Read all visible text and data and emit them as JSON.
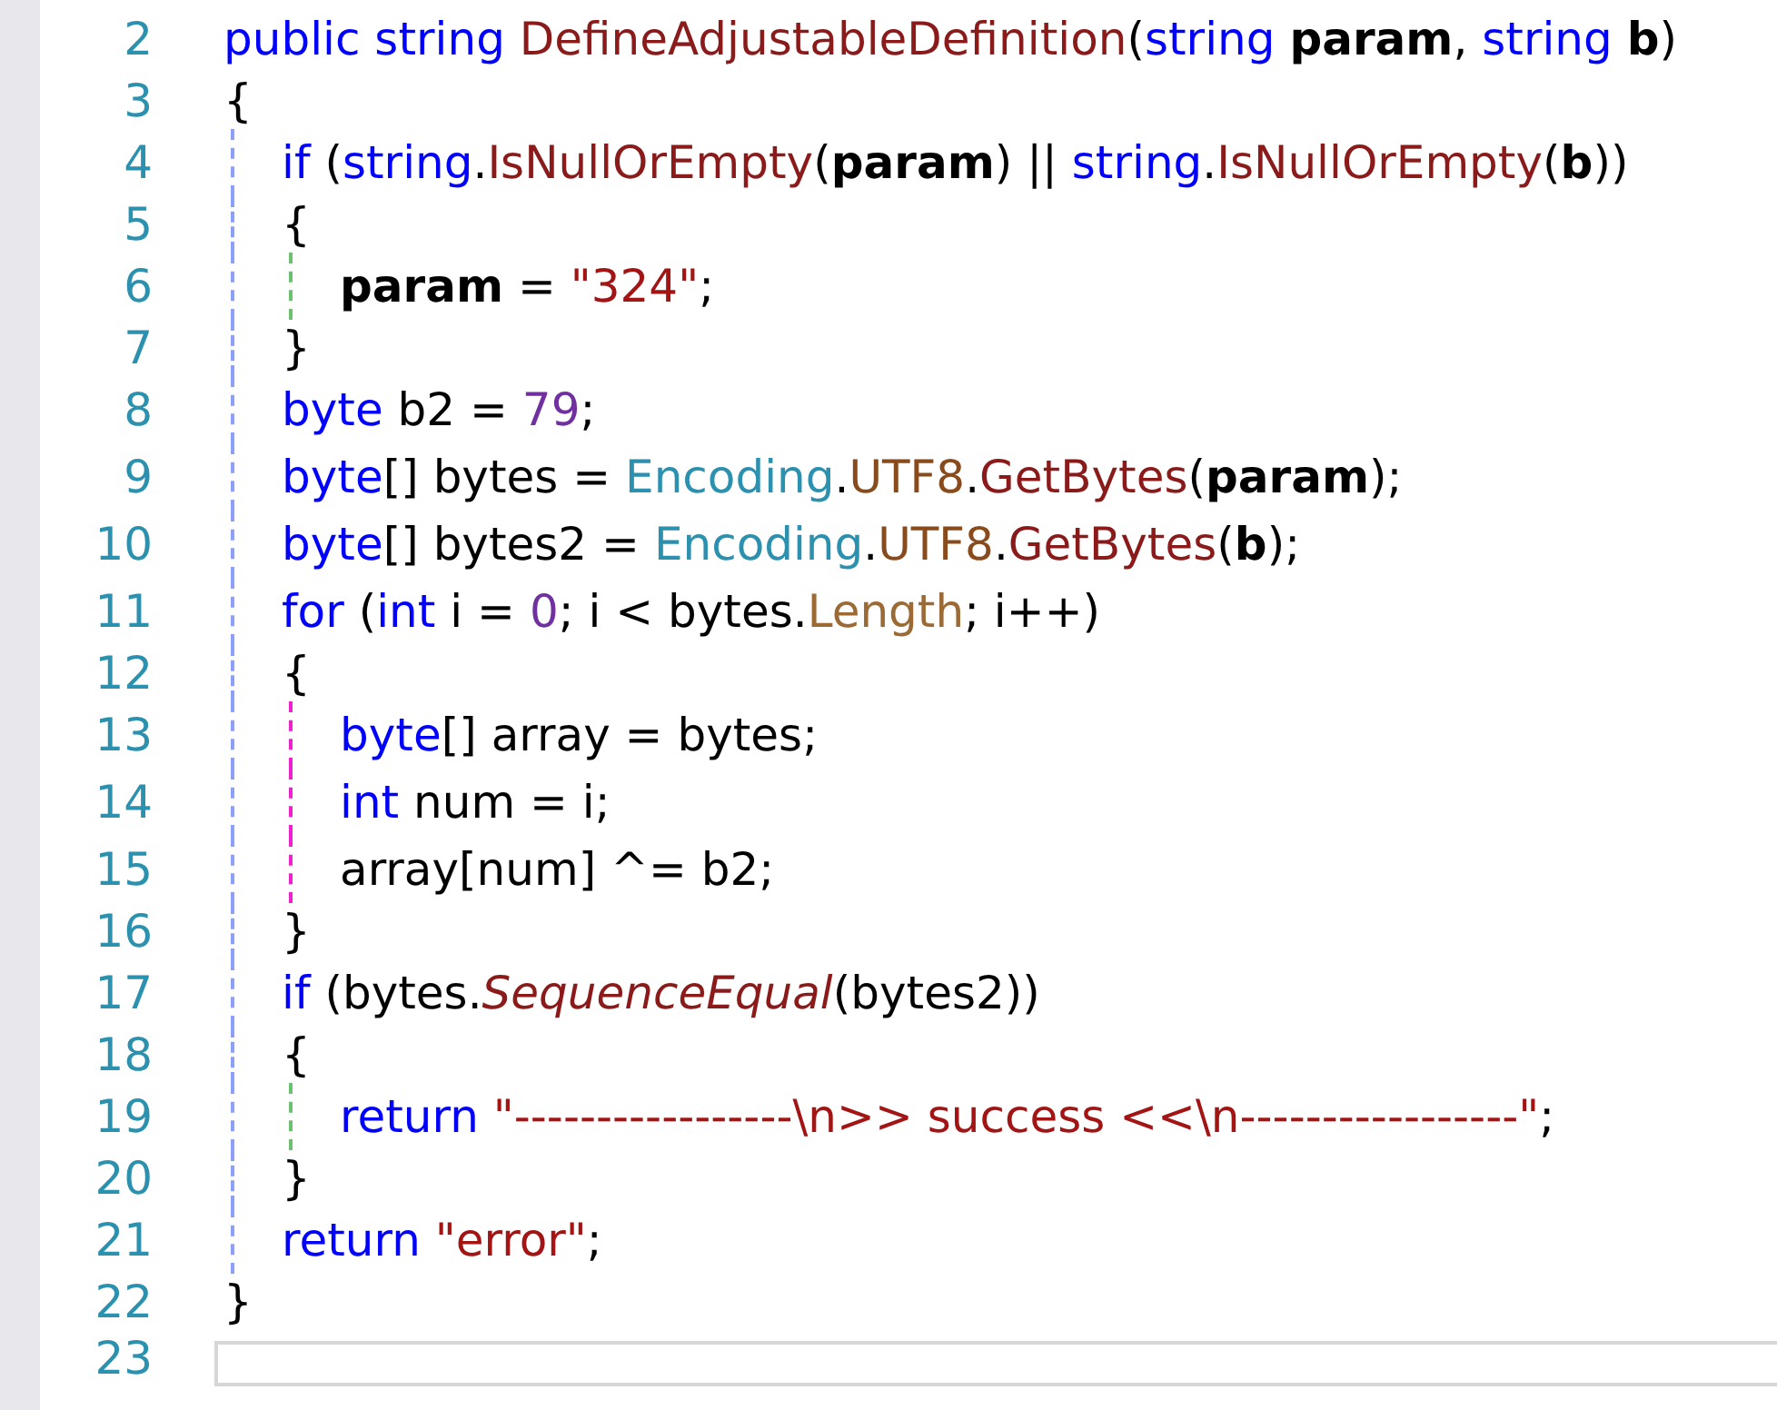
{
  "editor": {
    "lines": [
      {
        "number": "2",
        "kind": "code",
        "current": false,
        "tokens": [
          {
            "text": "public string ",
            "kind": "keyword"
          },
          {
            "text": "DefineAdjustableDefinition",
            "kind": "method"
          },
          {
            "text": "(",
            "kind": "plain"
          },
          {
            "text": "string ",
            "kind": "keyword"
          },
          {
            "text": "param",
            "kind": "param"
          },
          {
            "text": ", ",
            "kind": "plain"
          },
          {
            "text": "string ",
            "kind": "keyword"
          },
          {
            "text": "b",
            "kind": "param"
          },
          {
            "text": ")",
            "kind": "plain"
          }
        ]
      },
      {
        "number": "3",
        "kind": "brace",
        "current": false,
        "tokens": [
          {
            "text": "{",
            "kind": "plain"
          }
        ]
      },
      {
        "number": "4",
        "kind": "code",
        "current": false,
        "guides": [
          {
            "color": "#8c9ffa"
          }
        ],
        "tokens": [
          {
            "text": "if ",
            "kind": "keyword"
          },
          {
            "text": "(",
            "kind": "plain"
          },
          {
            "text": "string",
            "kind": "keyword"
          },
          {
            "text": ".",
            "kind": "plain"
          },
          {
            "text": "IsNullOrEmpty",
            "kind": "method"
          },
          {
            "text": "(",
            "kind": "plain"
          },
          {
            "text": "param",
            "kind": "param"
          },
          {
            "text": ") || ",
            "kind": "plain"
          },
          {
            "text": "string",
            "kind": "keyword"
          },
          {
            "text": ".",
            "kind": "plain"
          },
          {
            "text": "IsNullOrEmpty",
            "kind": "method"
          },
          {
            "text": "(",
            "kind": "plain"
          },
          {
            "text": "b",
            "kind": "param"
          },
          {
            "text": "))",
            "kind": "plain"
          }
        ]
      },
      {
        "number": "5",
        "kind": "brace",
        "current": false,
        "guides": [
          {
            "color": "#8c9ffa"
          }
        ],
        "tokens": [
          {
            "text": "{",
            "kind": "plain"
          }
        ]
      },
      {
        "number": "6",
        "kind": "code",
        "current": false,
        "guides": [
          {
            "color": "#8c9ffa"
          },
          {
            "color": "#6cc070"
          }
        ],
        "tokens": [
          {
            "text": "param",
            "kind": "param"
          },
          {
            "text": " = ",
            "kind": "plain"
          },
          {
            "text": "\"324\"",
            "kind": "string"
          },
          {
            "text": ";",
            "kind": "plain"
          }
        ]
      },
      {
        "number": "7",
        "kind": "brace",
        "current": false,
        "guides": [
          {
            "color": "#8c9ffa"
          }
        ],
        "tokens": [
          {
            "text": "}",
            "kind": "plain"
          }
        ]
      },
      {
        "number": "8",
        "kind": "code",
        "current": false,
        "guides": [
          {
            "color": "#8c9ffa"
          }
        ],
        "tokens": [
          {
            "text": "byte",
            "kind": "keyword"
          },
          {
            "text": " b2 = ",
            "kind": "plain"
          },
          {
            "text": "79",
            "kind": "number"
          },
          {
            "text": ";",
            "kind": "plain"
          }
        ]
      },
      {
        "number": "9",
        "kind": "code",
        "current": false,
        "guides": [
          {
            "color": "#8c9ffa"
          }
        ],
        "tokens": [
          {
            "text": "byte",
            "kind": "keyword"
          },
          {
            "text": "[] bytes = ",
            "kind": "plain"
          },
          {
            "text": "Encoding",
            "kind": "type"
          },
          {
            "text": ".",
            "kind": "plain"
          },
          {
            "text": "UTF8",
            "kind": "property"
          },
          {
            "text": ".",
            "kind": "plain"
          },
          {
            "text": "GetBytes",
            "kind": "method"
          },
          {
            "text": "(",
            "kind": "plain"
          },
          {
            "text": "param",
            "kind": "param"
          },
          {
            "text": ");",
            "kind": "plain"
          }
        ]
      },
      {
        "number": "10",
        "kind": "code",
        "current": false,
        "guides": [
          {
            "color": "#8c9ffa"
          }
        ],
        "tokens": [
          {
            "text": "byte",
            "kind": "keyword"
          },
          {
            "text": "[] bytes2 = ",
            "kind": "plain"
          },
          {
            "text": "Encoding",
            "kind": "type"
          },
          {
            "text": ".",
            "kind": "plain"
          },
          {
            "text": "UTF8",
            "kind": "property"
          },
          {
            "text": ".",
            "kind": "plain"
          },
          {
            "text": "GetBytes",
            "kind": "method"
          },
          {
            "text": "(",
            "kind": "plain"
          },
          {
            "text": "b",
            "kind": "param"
          },
          {
            "text": ");",
            "kind": "plain"
          }
        ]
      },
      {
        "number": "11",
        "kind": "code",
        "current": false,
        "guides": [
          {
            "color": "#8c9ffa"
          }
        ],
        "tokens": [
          {
            "text": "for ",
            "kind": "keyword"
          },
          {
            "text": "(",
            "kind": "plain"
          },
          {
            "text": "int ",
            "kind": "keyword"
          },
          {
            "text": "i = ",
            "kind": "plain"
          },
          {
            "text": "0",
            "kind": "number"
          },
          {
            "text": "; i < bytes.",
            "kind": "plain"
          },
          {
            "text": "Length",
            "kind": "member"
          },
          {
            "text": "; i++)",
            "kind": "plain"
          }
        ]
      },
      {
        "number": "12",
        "kind": "brace",
        "current": false,
        "guides": [
          {
            "color": "#8c9ffa"
          }
        ],
        "tokens": [
          {
            "text": "{",
            "kind": "plain"
          }
        ]
      },
      {
        "number": "13",
        "kind": "code",
        "current": false,
        "guides": [
          {
            "color": "#8c9ffa"
          },
          {
            "color": "#f020d0"
          }
        ],
        "tokens": [
          {
            "text": "byte",
            "kind": "keyword"
          },
          {
            "text": "[] array = bytes;",
            "kind": "plain"
          }
        ]
      },
      {
        "number": "14",
        "kind": "code",
        "current": false,
        "guides": [
          {
            "color": "#8c9ffa"
          },
          {
            "color": "#f020d0"
          }
        ],
        "tokens": [
          {
            "text": "int ",
            "kind": "keyword"
          },
          {
            "text": "num = i;",
            "kind": "plain"
          }
        ]
      },
      {
        "number": "15",
        "kind": "code",
        "current": false,
        "guides": [
          {
            "color": "#8c9ffa"
          },
          {
            "color": "#f020d0"
          }
        ],
        "tokens": [
          {
            "text": "array[num] ^= b2;",
            "kind": "plain"
          }
        ]
      },
      {
        "number": "16",
        "kind": "brace",
        "current": false,
        "guides": [
          {
            "color": "#8c9ffa"
          }
        ],
        "tokens": [
          {
            "text": "}",
            "kind": "plain"
          }
        ]
      },
      {
        "number": "17",
        "kind": "code",
        "current": false,
        "guides": [
          {
            "color": "#8c9ffa"
          }
        ],
        "tokens": [
          {
            "text": "if ",
            "kind": "keyword"
          },
          {
            "text": "(bytes.",
            "kind": "plain"
          },
          {
            "text": "SequenceEqual",
            "kind": "extension"
          },
          {
            "text": "(bytes2))",
            "kind": "plain"
          }
        ]
      },
      {
        "number": "18",
        "kind": "brace",
        "current": false,
        "guides": [
          {
            "color": "#8c9ffa"
          }
        ],
        "tokens": [
          {
            "text": "{",
            "kind": "plain"
          }
        ]
      },
      {
        "number": "19",
        "kind": "code",
        "current": false,
        "guides": [
          {
            "color": "#8c9ffa"
          },
          {
            "color": "#6cc070"
          }
        ],
        "tokens": [
          {
            "text": "return ",
            "kind": "keyword"
          },
          {
            "text": "\"-----------------\\n>> success <<\\n-----------------\"",
            "kind": "string"
          },
          {
            "text": ";",
            "kind": "plain"
          }
        ]
      },
      {
        "number": "20",
        "kind": "brace",
        "current": false,
        "guides": [
          {
            "color": "#8c9ffa"
          }
        ],
        "tokens": [
          {
            "text": "}",
            "kind": "plain"
          }
        ]
      },
      {
        "number": "21",
        "kind": "code",
        "current": false,
        "guides": [
          {
            "color": "#8c9ffa"
          }
        ],
        "tokens": [
          {
            "text": "return ",
            "kind": "keyword"
          },
          {
            "text": "\"error\"",
            "kind": "string"
          },
          {
            "text": ";",
            "kind": "plain"
          }
        ]
      },
      {
        "number": "22",
        "kind": "brace",
        "current": false,
        "tokens": [
          {
            "text": "}",
            "kind": "plain"
          }
        ]
      },
      {
        "number": "23",
        "kind": "brace",
        "current": true
      }
    ]
  }
}
